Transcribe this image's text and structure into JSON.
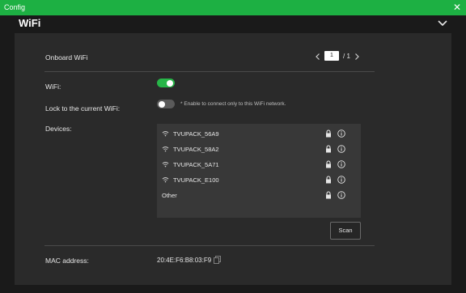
{
  "window": {
    "title": "Config",
    "close_glyph": "✕"
  },
  "section": {
    "title": "WiFi"
  },
  "onboard": {
    "label": "Onboard WiFi",
    "page_value": "1",
    "page_total": "/ 1"
  },
  "wifi": {
    "label": "WiFi:",
    "enabled": true
  },
  "lock": {
    "label": "Lock to the current WiFi:",
    "enabled": false,
    "hint": "* Enable to connect only to this WiFi network."
  },
  "devices": {
    "label": "Devices:",
    "items": [
      {
        "name": "TVUPACK_56A9",
        "wifi_icon": true
      },
      {
        "name": "TVUPACK_58A2",
        "wifi_icon": true
      },
      {
        "name": "TVUPACK_5A71",
        "wifi_icon": true
      },
      {
        "name": "TVUPACK_E100",
        "wifi_icon": true
      },
      {
        "name": "Other",
        "wifi_icon": false
      }
    ]
  },
  "scan": {
    "label": "Scan"
  },
  "mac": {
    "label": "MAC address:",
    "value": "20:4E:F6:B8:03:F9"
  },
  "colors": {
    "titlebar": "#1db043",
    "toggle_on": "#27b548",
    "toggle_off": "#5a5a5a"
  }
}
